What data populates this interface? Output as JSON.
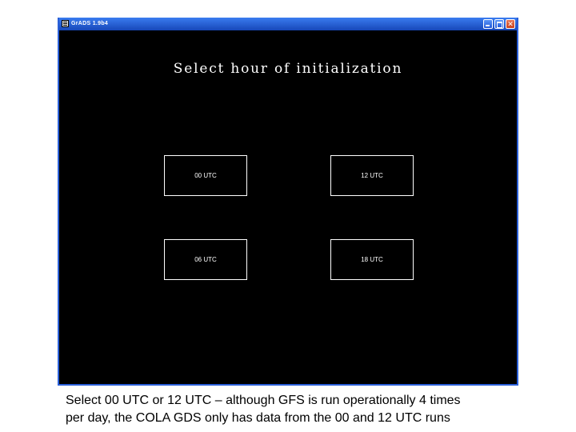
{
  "window": {
    "title": "GrADS 1.9b4",
    "app_icon": "grads-app-icon",
    "controls": [
      "minimize-icon",
      "maximize-icon",
      "close-icon"
    ]
  },
  "screen": {
    "title": "Select hour of initialization",
    "buttons": [
      {
        "label": "00 UTC"
      },
      {
        "label": "12 UTC"
      },
      {
        "label": "06 UTC"
      },
      {
        "label": "18 UTC"
      }
    ]
  },
  "caption": {
    "line1": "Select 00 UTC or 12 UTC – although GFS is run operationally 4 times",
    "line2": "per day, the COLA GDS only has data from the 00 and 12 UTC runs"
  },
  "colors": {
    "titlebar": "#1747b8",
    "canvas": "#000000",
    "foreground": "#ffffff"
  }
}
